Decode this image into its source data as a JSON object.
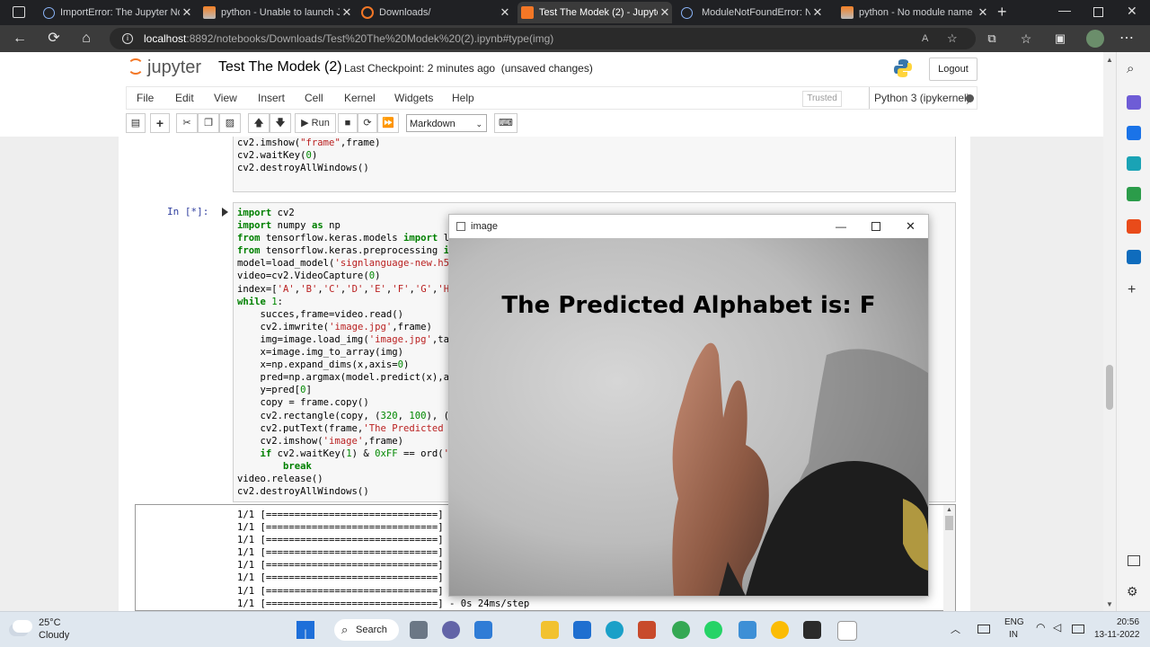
{
  "tabs": [
    {
      "title": "ImportError: The Jupyter No",
      "active": false
    },
    {
      "title": "python - Unable to launch J",
      "active": false
    },
    {
      "title": "Downloads/",
      "active": false
    },
    {
      "title": "Test The Modek (2) - Jupyte",
      "active": true
    },
    {
      "title": "ModuleNotFoundError: No",
      "active": false
    },
    {
      "title": "python - No module name",
      "active": false
    }
  ],
  "address": {
    "host": "localhost",
    "rest": ":8892/notebooks/Downloads/Test%20The%20Modek%20(2).ipynb#type(img)"
  },
  "jupyter": {
    "logo_text": "jupyter",
    "notebook_name": "Test The Modek (2)",
    "checkpoint": "Last Checkpoint: 2 minutes ago",
    "unsaved": "(unsaved changes)",
    "logout": "Logout"
  },
  "menu": [
    "File",
    "Edit",
    "View",
    "Insert",
    "Cell",
    "Kernel",
    "Widgets",
    "Help"
  ],
  "trusted": "Trusted",
  "kernel_name": "Python 3 (ipykernel)",
  "toolbar": {
    "run_label": "Run",
    "cell_type": "Markdown"
  },
  "prev_cell_lines": [
    "cv2.imshow(\"frame\",frame)",
    "cv2.waitKey(0)",
    "cv2.destroyAllWindows()"
  ],
  "prompt": "In [*]:",
  "output_lines": [
    "1/1 [==============================]",
    "1/1 [==============================]",
    "1/1 [==============================]",
    "1/1 [==============================]",
    "1/1 [==============================]",
    "1/1 [==============================]",
    "1/1 [==============================]",
    "1/1 [==============================] - 0s 24ms/step"
  ],
  "cv_window": {
    "title": "image",
    "predicted_text": "The Predicted Alphabet is: F"
  },
  "taskbar": {
    "temp": "25°C",
    "weather": "Cloudy",
    "search": "Search",
    "lang1": "ENG",
    "lang2": "IN",
    "time": "20:56",
    "date": "13-11-2022"
  }
}
